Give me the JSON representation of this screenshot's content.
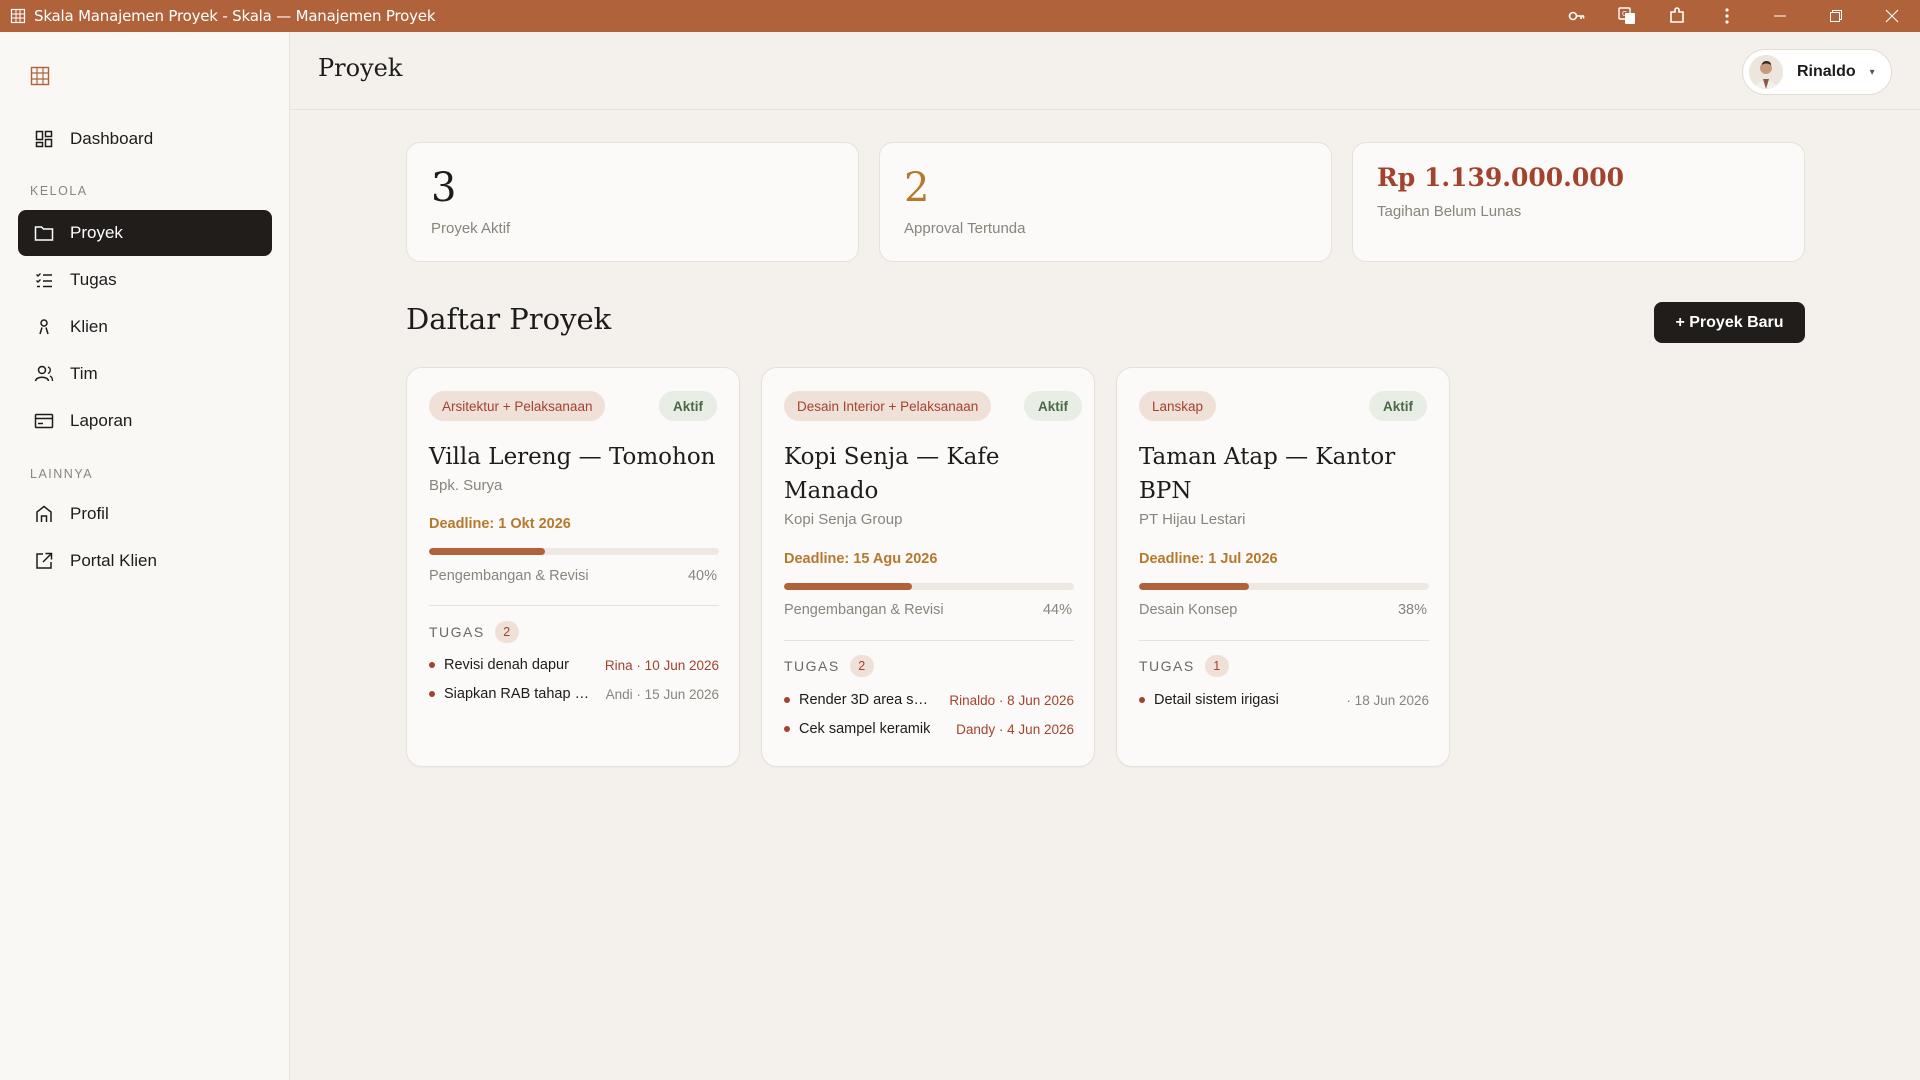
{
  "window": {
    "title": "Skala Manajemen Proyek - Skala — Manajemen Proyek"
  },
  "sidebar": {
    "items": [
      {
        "label": "Dashboard",
        "icon": "dashboard-icon"
      },
      {
        "label": "Proyek",
        "icon": "folder-icon",
        "active": true
      },
      {
        "label": "Tugas",
        "icon": "checklist-icon"
      },
      {
        "label": "Klien",
        "icon": "user-icon"
      },
      {
        "label": "Tim",
        "icon": "team-icon"
      },
      {
        "label": "Laporan",
        "icon": "report-card-icon"
      },
      {
        "label": "Profil",
        "icon": "home-icon"
      },
      {
        "label": "Portal Klien",
        "icon": "external-link-icon"
      }
    ],
    "sections": {
      "kelola": "KELOLA",
      "lainnya": "LAINNYA"
    }
  },
  "header": {
    "title": "Proyek",
    "user_name": "Rinaldo"
  },
  "stats": [
    {
      "value": "3",
      "label": "Proyek Aktif"
    },
    {
      "value": "2",
      "label": "Approval Tertunda"
    },
    {
      "value": "Rp 1.139.000.000",
      "label": "Tagihan Belum Lunas"
    }
  ],
  "list": {
    "title": "Daftar Proyek",
    "new_button": "+ Proyek Baru"
  },
  "projects": [
    {
      "category": "Arsitektur + Pelaksanaan",
      "status": "Aktif",
      "name": "Villa Lereng — Tomohon",
      "client": "Bpk. Surya",
      "deadline": "Deadline: 1 Okt 2026",
      "progress": 0.4,
      "phase": "Pengembangan & Revisi",
      "percent": "40%",
      "tasks_label": "TUGAS",
      "task_count": "2",
      "tasks": [
        {
          "name": "Revisi denah dapur",
          "meta": "Rina · 10 Jun 2026",
          "tone": "red"
        },
        {
          "name": "Siapkan RAB tahap …",
          "meta": "Andi · 15 Jun 2026",
          "tone": "gray"
        }
      ]
    },
    {
      "category": "Desain Interior + Pelaksanaan",
      "status": "Aktif",
      "name": "Kopi Senja — Kafe Manado",
      "client": "Kopi Senja Group",
      "deadline": "Deadline: 15 Agu 2026",
      "progress": 0.44,
      "phase": "Pengembangan & Revisi",
      "percent": "44%",
      "tasks_label": "TUGAS",
      "task_count": "2",
      "tasks": [
        {
          "name": "Render 3D area s…",
          "meta": "Rinaldo · 8 Jun 2026",
          "tone": "red"
        },
        {
          "name": "Cek sampel keramik",
          "meta": "Dandy · 4 Jun 2026",
          "tone": "red"
        }
      ]
    },
    {
      "category": "Lanskap",
      "status": "Aktif",
      "name": "Taman Atap — Kantor BPN",
      "client": "PT Hijau Lestari",
      "deadline": "Deadline: 1 Jul 2026",
      "progress": 0.38,
      "phase": "Desain Konsep",
      "percent": "38%",
      "tasks_label": "TUGAS",
      "task_count": "1",
      "tasks": [
        {
          "name": "Detail sistem irigasi",
          "meta": "· 18 Jun 2026",
          "tone": "gray"
        }
      ]
    }
  ],
  "colors": {
    "accent": "#b0623b",
    "sidebar_active": "#211d1a",
    "danger": "#a3432e",
    "deadline": "#b5792d"
  }
}
